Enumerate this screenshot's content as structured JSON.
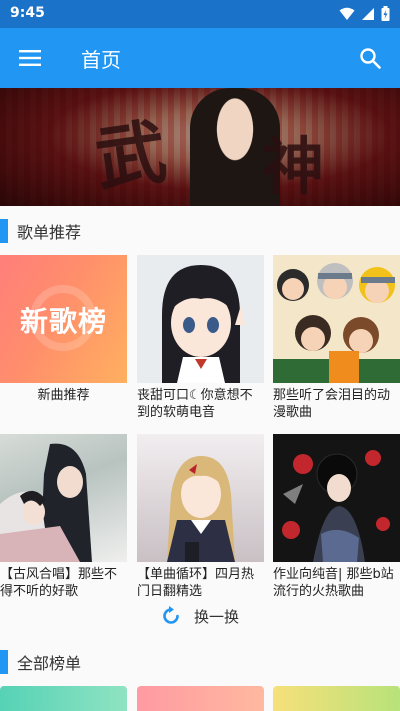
{
  "status": {
    "time": "9:45"
  },
  "app_bar": {
    "title": "首页"
  },
  "banner": {
    "calligraphy_left": "武",
    "calligraphy_right": "神"
  },
  "sections": {
    "recommended": "歌单推荐",
    "all_charts": "全部榜单"
  },
  "playlists": [
    {
      "name": "新曲推荐",
      "cover_text": "新歌榜"
    },
    {
      "name": "丧甜可口☾你意想不到的软萌电音"
    },
    {
      "name": "那些听了会泪目的动漫歌曲"
    },
    {
      "name": "【古风合唱】那些不得不听的好歌"
    },
    {
      "name": "【单曲循环】四月热门日翻精选"
    },
    {
      "name": "作业向纯音| 那些b站流行的火热歌曲"
    }
  ],
  "refresh": {
    "label": "换一换"
  },
  "colors": {
    "primary": "#2196f3",
    "status_bar": "#1b73c9"
  },
  "icons": {
    "menu": "menu-icon",
    "search": "search-icon",
    "refresh": "refresh-icon"
  }
}
